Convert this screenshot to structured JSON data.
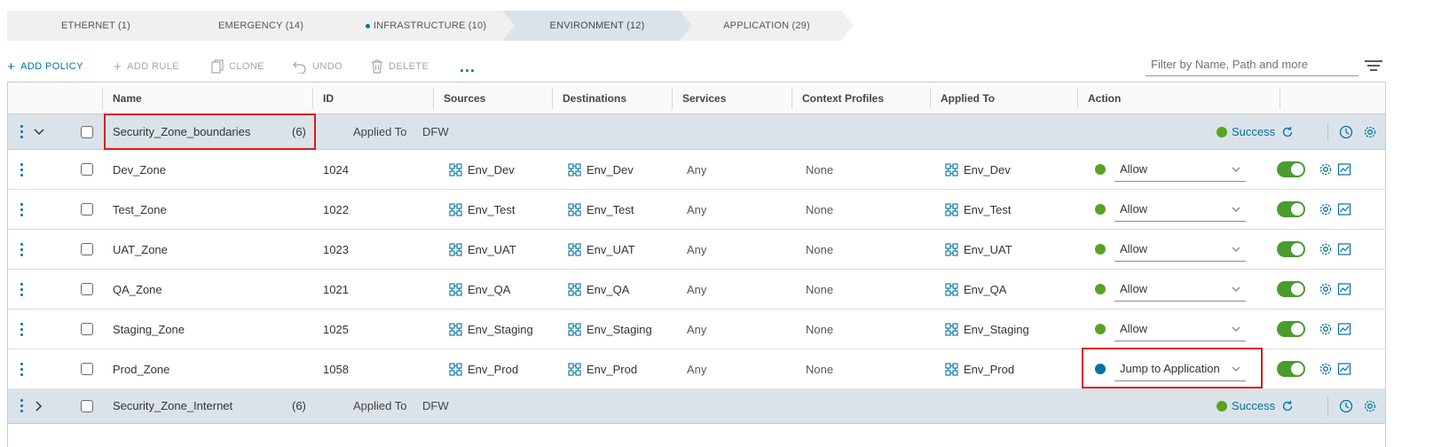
{
  "category_tabs": [
    {
      "label": "ETHERNET (1)",
      "active": false,
      "dot": false
    },
    {
      "label": "EMERGENCY (14)",
      "active": false,
      "dot": false
    },
    {
      "label": "INFRASTRUCTURE (10)",
      "active": false,
      "dot": true
    },
    {
      "label": "ENVIRONMENT (12)",
      "active": true,
      "dot": false
    },
    {
      "label": "APPLICATION (29)",
      "active": false,
      "dot": false
    }
  ],
  "toolbar": {
    "add_policy": "ADD POLICY",
    "add_rule": "ADD RULE",
    "clone": "CLONE",
    "undo": "UNDO",
    "delete": "DELETE",
    "more": "...",
    "filter_placeholder": "Filter by Name, Path and more"
  },
  "columns": {
    "name": "Name",
    "id": "ID",
    "sources": "Sources",
    "destinations": "Destinations",
    "services": "Services",
    "context_profiles": "Context Profiles",
    "applied_to": "Applied To",
    "action": "Action"
  },
  "groups": [
    {
      "name": "Security_Zone_boundaries",
      "count": "(6)",
      "applied_to_label": "Applied To",
      "applied_to_value": "DFW",
      "status": "Success",
      "expanded": true,
      "rules": [
        {
          "name": "Dev_Zone",
          "id": "1024",
          "source": "Env_Dev",
          "destination": "Env_Dev",
          "services": "Any",
          "context_profiles": "None",
          "applied_to": "Env_Dev",
          "action": "Allow",
          "action_color": "#5aa220"
        },
        {
          "name": "Test_Zone",
          "id": "1022",
          "source": "Env_Test",
          "destination": "Env_Test",
          "services": "Any",
          "context_profiles": "None",
          "applied_to": "Env_Test",
          "action": "Allow",
          "action_color": "#5aa220"
        },
        {
          "name": "UAT_Zone",
          "id": "1023",
          "source": "Env_UAT",
          "destination": "Env_UAT",
          "services": "Any",
          "context_profiles": "None",
          "applied_to": "Env_UAT",
          "action": "Allow",
          "action_color": "#5aa220"
        },
        {
          "name": "QA_Zone",
          "id": "1021",
          "source": "Env_QA",
          "destination": "Env_QA",
          "services": "Any",
          "context_profiles": "None",
          "applied_to": "Env_QA",
          "action": "Allow",
          "action_color": "#5aa220"
        },
        {
          "name": "Staging_Zone",
          "id": "1025",
          "source": "Env_Staging",
          "destination": "Env_Staging",
          "services": "Any",
          "context_profiles": "None",
          "applied_to": "Env_Staging",
          "action": "Allow",
          "action_color": "#5aa220"
        },
        {
          "name": "Prod_Zone",
          "id": "1058",
          "source": "Env_Prod",
          "destination": "Env_Prod",
          "services": "Any",
          "context_profiles": "None",
          "applied_to": "Env_Prod",
          "action": "Jump to Application",
          "action_color": "#0072a3"
        }
      ]
    },
    {
      "name": "Security_Zone_Internet",
      "count": "(6)",
      "applied_to_label": "Applied To",
      "applied_to_value": "DFW",
      "status": "Success",
      "expanded": false,
      "rules": []
    }
  ],
  "colors": {
    "accent": "#0072a3",
    "success": "#5aa220",
    "highlight": "#d91c1c",
    "group_bg": "#dbe3ea"
  }
}
